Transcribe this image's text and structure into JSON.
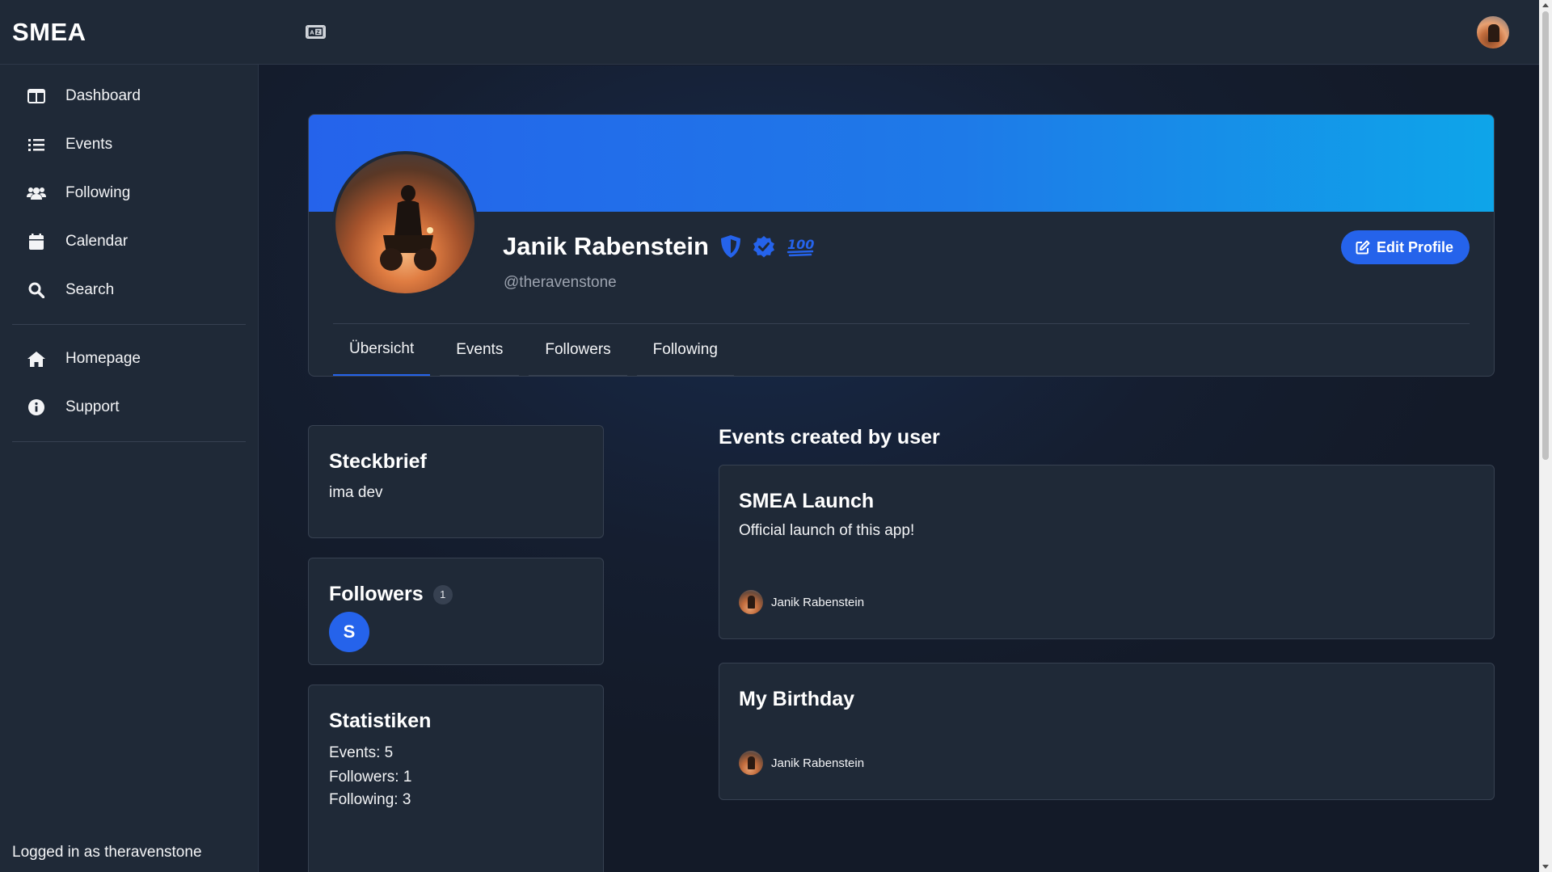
{
  "app": {
    "brand": "SMEA"
  },
  "topbar": {
    "language_icon": "language-icon",
    "avatar_icon": "user-avatar"
  },
  "sidebar": {
    "items": [
      {
        "label": "Dashboard",
        "icon": "dashboard-icon"
      },
      {
        "label": "Events",
        "icon": "list-icon"
      },
      {
        "label": "Following",
        "icon": "users-icon"
      },
      {
        "label": "Calendar",
        "icon": "calendar-icon"
      },
      {
        "label": "Search",
        "icon": "search-icon"
      }
    ],
    "secondary": [
      {
        "label": "Homepage",
        "icon": "home-icon"
      },
      {
        "label": "Support",
        "icon": "info-icon"
      }
    ],
    "logged_in": "Logged in as theravenstone"
  },
  "profile": {
    "name": "Janik Rabenstein",
    "handle": "@theravenstone",
    "edit_label": "Edit Profile",
    "badges": [
      "shield-icon",
      "verified-icon",
      "hundred-points-icon"
    ],
    "banner_colors": [
      "#2563eb",
      "#0ea5e9"
    ],
    "tabs": [
      "Übersicht",
      "Events",
      "Followers",
      "Following"
    ],
    "active_tab": "Übersicht"
  },
  "steckbrief": {
    "title": "Steckbrief",
    "text": "ima dev"
  },
  "followers": {
    "title": "Followers",
    "count": "1",
    "avatars": [
      "S"
    ]
  },
  "statistiken": {
    "title": "Statistiken",
    "lines": [
      "Events: 5",
      "Followers: 1",
      "Following: 3"
    ]
  },
  "events": {
    "section_title": "Events created by user",
    "items": [
      {
        "title": "SMEA Launch",
        "description": "Official launch of this app!",
        "author": "Janik Rabenstein"
      },
      {
        "title": "My Birthday",
        "description": "",
        "author": "Janik Rabenstein"
      }
    ]
  },
  "colors": {
    "accent": "#2563eb",
    "background": "#151d2c",
    "surface": "#1f2937"
  }
}
